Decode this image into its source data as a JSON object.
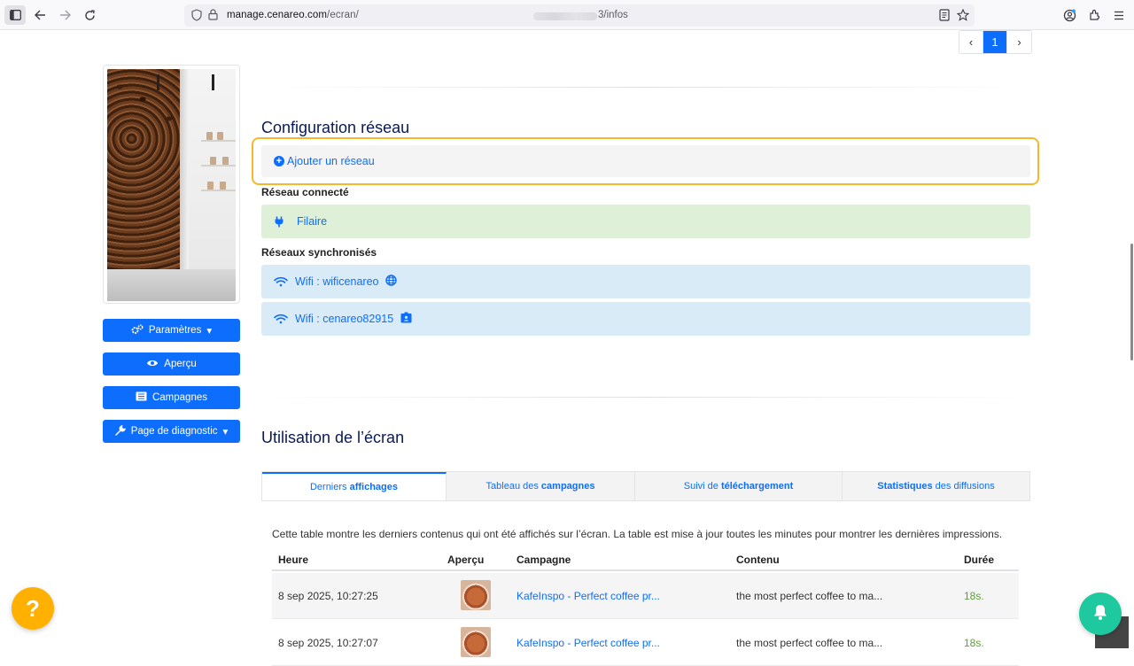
{
  "browser": {
    "url_domain": "manage.cenareo.com",
    "url_path": "/ecran/",
    "url_suffix": "3/infos"
  },
  "pagination": {
    "prev": "‹",
    "current": "1",
    "next": "›"
  },
  "sidebar": {
    "buttons": [
      {
        "label": "Paramètres",
        "icon": "gears-icon",
        "has_caret": true
      },
      {
        "label": "Aperçu",
        "icon": "eye-icon",
        "has_caret": false
      },
      {
        "label": "Campagnes",
        "icon": "list-icon",
        "has_caret": false
      },
      {
        "label": "Page de diagnostic",
        "icon": "wrench-icon",
        "has_caret": true
      }
    ]
  },
  "network": {
    "title": "Configuration réseau",
    "add_label": "Ajouter un réseau",
    "connected_label": "Réseau connecté",
    "connected": [
      {
        "name": "Filaire",
        "type": "plug-icon",
        "color": "#dff0d8"
      }
    ],
    "synced_label": "Réseaux synchronisés",
    "synced": [
      {
        "name": "Wifi : wificenareo",
        "type": "wifi-icon",
        "badge": "globe-icon",
        "color": "#d9ebf7"
      },
      {
        "name": "Wifi : cenareo82915",
        "type": "wifi-icon",
        "badge": "id-badge-icon",
        "color": "#d9ebf7"
      }
    ]
  },
  "usage": {
    "title": "Utilisation de l’écran",
    "tabs": [
      {
        "pre": "Derniers ",
        "bold": "affichages",
        "post": "",
        "active": true
      },
      {
        "pre": "Tableau des ",
        "bold": "campagnes",
        "post": "",
        "active": false
      },
      {
        "pre": "Suivi de ",
        "bold": "téléchargement",
        "post": "",
        "active": false
      },
      {
        "pre": "",
        "bold": "Statistiques",
        "post": " des diffusions",
        "active": false
      }
    ],
    "description": "Cette table montre les derniers contenus qui ont été affichés sur l’écran. La table est mise à jour toutes les minutes pour montrer les dernières impressions.",
    "columns": {
      "time": "Heure",
      "preview": "Aperçu",
      "campaign": "Campagne",
      "content": "Contenu",
      "duration": "Durée"
    },
    "rows": [
      {
        "time": "8 sep 2025, 10:27:25",
        "campaign": "KafeInspo - Perfect coffee pr...",
        "content": "the most perfect coffee to ma...",
        "duration": "18s."
      },
      {
        "time": "8 sep 2025, 10:27:07",
        "campaign": "KafeInspo - Perfect coffee pr...",
        "content": "the most perfect coffee to ma...",
        "duration": "18s."
      }
    ]
  },
  "floating": {
    "help": "?",
    "scroll_top": "⌃"
  },
  "colors": {
    "primary": "#0d6efd",
    "highlight": "#f5b829",
    "help": "#ffb000",
    "notif": "#1ec9a0",
    "title": "#0a1a55"
  }
}
